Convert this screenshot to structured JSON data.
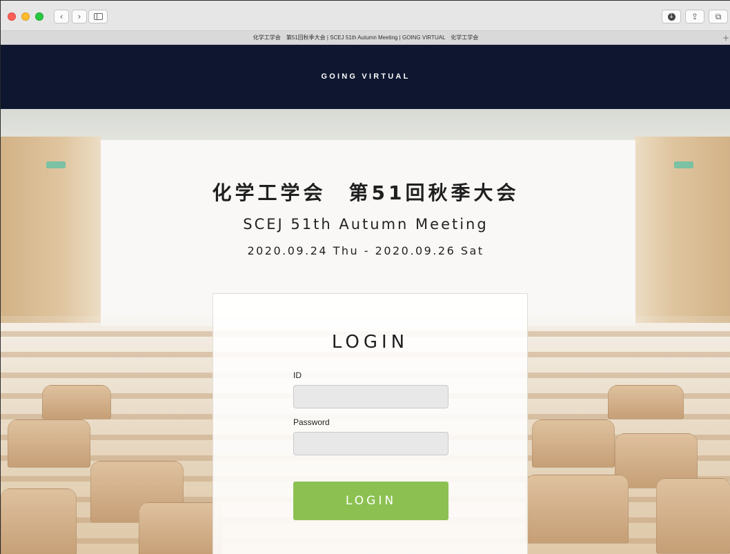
{
  "browser": {
    "tab_title": "化学工学会　第51回秋季大会 | SCEJ 51th Autumn Meeting | GOING VIRTUAL　化学工学会",
    "back_glyph": "‹",
    "forward_glyph": "›",
    "new_tab_glyph": "+",
    "download_glyph": "↓",
    "share_glyph": "⇪",
    "tabs_glyph": "⧉"
  },
  "header": {
    "brand": "GOING VIRTUAL"
  },
  "hero": {
    "title_ja": "化学工学会　第51回秋季大会",
    "subtitle": "SCEJ 51th Autumn Meeting",
    "dates": "2020.09.24 Thu - 2020.09.26 Sat"
  },
  "login": {
    "heading": "LOGIN",
    "id_label": "ID",
    "id_value": "",
    "password_label": "Password",
    "password_value": "",
    "button_label": "LOGIN"
  },
  "colors": {
    "header_bg": "#0e1630",
    "button_bg": "#8cc152"
  },
  "icons": [
    "back-icon",
    "forward-icon",
    "sidebar-icon",
    "download-icon",
    "share-icon",
    "tabs-icon",
    "new-tab-icon"
  ]
}
